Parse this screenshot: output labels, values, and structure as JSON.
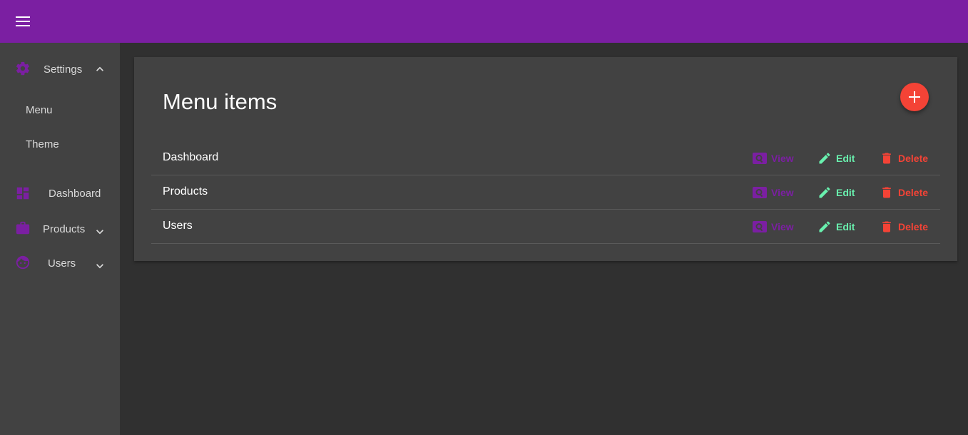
{
  "topbar": {
    "menu_icon": "hamburger-menu-icon",
    "color": "#7b1fa2"
  },
  "sidebar": {
    "settings": {
      "label": "Settings",
      "icon": "gear-icon",
      "expanded": true
    },
    "settings_children": [
      {
        "label": "Menu"
      },
      {
        "label": "Theme"
      }
    ],
    "dashboard": {
      "label": "Dashboard",
      "icon": "dashboard-icon"
    },
    "products": {
      "label": "Products",
      "icon": "briefcase-icon",
      "expanded": false
    },
    "users": {
      "label": "Users",
      "icon": "face-icon",
      "expanded": false
    }
  },
  "main": {
    "title": "Menu items",
    "add_icon": "plus-icon",
    "rows": [
      {
        "name": "Dashboard"
      },
      {
        "name": "Products"
      },
      {
        "name": "Users"
      }
    ],
    "actions": {
      "view": "View",
      "edit": "Edit",
      "delete": "Delete"
    }
  },
  "colors": {
    "primary": "#7b1fa2",
    "accent": "#69f0ae",
    "danger": "#f44336",
    "surface": "#424242",
    "background": "#303030"
  }
}
